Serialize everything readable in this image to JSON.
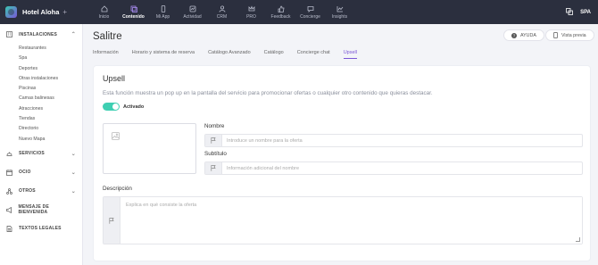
{
  "topbar": {
    "brand": "Hotel Aloha",
    "brand_action": "+",
    "nav": [
      {
        "label": "Inicio",
        "icon": "home-icon"
      },
      {
        "label": "Contenido",
        "icon": "content-icon"
      },
      {
        "label": "Mi App",
        "icon": "phone-icon"
      },
      {
        "label": "Actividad",
        "icon": "activity-icon"
      },
      {
        "label": "CRM",
        "icon": "users-icon"
      },
      {
        "label": "PRO",
        "icon": "crown-icon"
      },
      {
        "label": "Feedback",
        "icon": "thumbs-up-icon"
      },
      {
        "label": "Concierge",
        "icon": "chat-icon"
      },
      {
        "label": "Insights",
        "icon": "chart-icon"
      }
    ],
    "language": "SPA"
  },
  "sidebar": {
    "instalaciones": "INSTALACIONES",
    "sub_items": [
      "Restaurantes",
      "Spa",
      "Deportes",
      "Otras instalaciones",
      "Piscinas",
      "Camas balinesas",
      "Atracciones",
      "Tiendas",
      "Directorio",
      "Nuevo Mapa"
    ],
    "servicios": "SERVICIOS",
    "ocio": "OCIO",
    "otros": "OTROS",
    "bienvenida": "MENSAJE DE BIENVENIDA",
    "legales": "TEXTOS LEGALES"
  },
  "page": {
    "title": "Salitre",
    "help_label": "AYUDA",
    "preview_label": "Vista previa",
    "tabs": [
      "Información",
      "Horario y sistema de reserva",
      "Catálogo Avanzado",
      "Catálogo",
      "Concierge chat",
      "Upsell"
    ]
  },
  "upsell": {
    "title": "Upsell",
    "description": "Esta función muestra un pop up en la pantalla del servicio para promocionar ofertas o cualquier otro contenido que quieras destacar.",
    "toggle_label": "Activado",
    "nombre_label": "Nombre",
    "nombre_placeholder": "Introduce un nombre para la oferta",
    "subtitulo_label": "Subtítulo",
    "subtitulo_placeholder": "Información adicional del nombre",
    "descripcion_label": "Descripción",
    "descripcion_placeholder": "Explica en qué consiste la oferta"
  },
  "colors": {
    "accent": "#7b57d6",
    "toggle": "#3ecfb2",
    "topbar": "#2b2f3e"
  }
}
